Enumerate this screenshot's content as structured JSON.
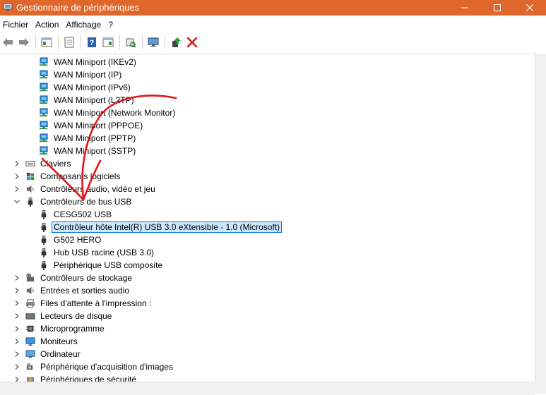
{
  "window": {
    "title": "Gestionnaire de périphériques"
  },
  "menu": {
    "items": [
      "Fichier",
      "Action",
      "Affichage",
      "?"
    ]
  },
  "toolbar": {
    "buttons": [
      "back-arrow-icon",
      "forward-arrow-icon",
      "console-tree-icon",
      "properties-icon",
      "help-icon",
      "action-pane-icon",
      "scan-hardware-icon",
      "monitor-icon",
      "update-driver-icon",
      "uninstall-device-icon"
    ]
  },
  "tree": {
    "rows": [
      {
        "label": "WAN Miniport (IKEv2)",
        "level": 2,
        "icon": "network-adapter-icon",
        "expander": "none"
      },
      {
        "label": "WAN Miniport (IP)",
        "level": 2,
        "icon": "network-adapter-icon",
        "expander": "none"
      },
      {
        "label": "WAN Miniport (IPv6)",
        "level": 2,
        "icon": "network-adapter-icon",
        "expander": "none"
      },
      {
        "label": "WAN Miniport (L2TP)",
        "level": 2,
        "icon": "network-adapter-icon",
        "expander": "none"
      },
      {
        "label": "WAN Miniport (Network Monitor)",
        "level": 2,
        "icon": "network-adapter-icon",
        "expander": "none"
      },
      {
        "label": "WAN Miniport (PPPOE)",
        "level": 2,
        "icon": "network-adapter-icon",
        "expander": "none"
      },
      {
        "label": "WAN Miniport (PPTP)",
        "level": 2,
        "icon": "network-adapter-icon",
        "expander": "none"
      },
      {
        "label": "WAN Miniport (SSTP)",
        "level": 2,
        "icon": "network-adapter-icon",
        "expander": "none"
      },
      {
        "label": "Claviers",
        "level": 1,
        "icon": "keyboard-icon",
        "expander": "collapsed"
      },
      {
        "label": "Composants logiciels",
        "level": 1,
        "icon": "software-component-icon",
        "expander": "collapsed"
      },
      {
        "label": "Contrôleurs audio, vidéo et jeu",
        "level": 1,
        "icon": "speaker-icon",
        "expander": "collapsed"
      },
      {
        "label": "Contrôleurs de bus USB",
        "level": 1,
        "icon": "usb-connector-icon",
        "expander": "expanded"
      },
      {
        "label": "CESG502 USB",
        "level": 2,
        "icon": "usb-connector-icon",
        "expander": "none"
      },
      {
        "label": "Contrôleur hôte Intel(R) USB 3.0 eXtensible - 1.0 (Microsoft)",
        "level": 2,
        "icon": "usb-connector-icon",
        "expander": "none",
        "selected": true
      },
      {
        "label": "G502 HERO",
        "level": 2,
        "icon": "usb-connector-icon",
        "expander": "none"
      },
      {
        "label": "Hub USB racine (USB 3.0)",
        "level": 2,
        "icon": "usb-connector-icon",
        "expander": "none"
      },
      {
        "label": "Périphérique USB composite",
        "level": 2,
        "icon": "usb-connector-icon",
        "expander": "none"
      },
      {
        "label": "Contrôleurs de stockage",
        "level": 1,
        "icon": "storage-controller-icon",
        "expander": "collapsed"
      },
      {
        "label": "Entrées et sorties audio",
        "level": 1,
        "icon": "speaker-icon",
        "expander": "collapsed"
      },
      {
        "label": "Files d'attente à l'impression :",
        "level": 1,
        "icon": "printer-icon",
        "expander": "collapsed"
      },
      {
        "label": "Lecteurs de disque",
        "level": 1,
        "icon": "disk-drive-icon",
        "expander": "collapsed"
      },
      {
        "label": "Microprogramme",
        "level": 1,
        "icon": "firmware-chip-icon",
        "expander": "collapsed"
      },
      {
        "label": "Moniteurs",
        "level": 1,
        "icon": "monitor-icon",
        "expander": "collapsed"
      },
      {
        "label": "Ordinateur",
        "level": 1,
        "icon": "computer-icon",
        "expander": "collapsed"
      },
      {
        "label": "Périphérique d'acquisition d'images",
        "level": 1,
        "icon": "camera-icon",
        "expander": "collapsed"
      },
      {
        "label": "Périphériques de sécurité",
        "level": 1,
        "icon": "security-key-icon",
        "expander": "collapsed"
      }
    ]
  },
  "colors": {
    "titlebar": "#e0672b",
    "selection_bg": "#cce8ff",
    "selection_border": "#0078d7",
    "annotation": "#e3141b"
  }
}
